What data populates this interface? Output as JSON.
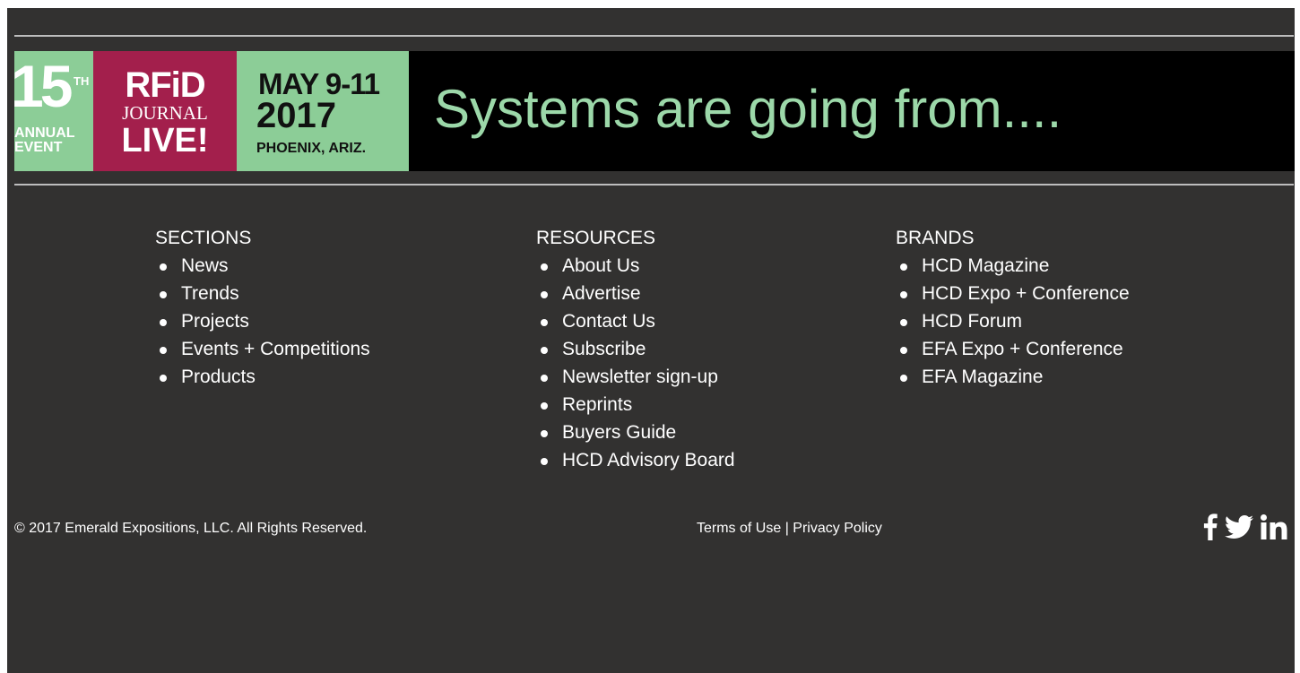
{
  "banner": {
    "number": "15",
    "number_suffix": "TH",
    "annual": "ANNUAL",
    "event": "EVENT",
    "brand_top": "RFiD",
    "brand_mid": "JOURNAL",
    "brand_bottom": "LIVE!",
    "date": "MAY 9-11",
    "year": "2017",
    "city": "PHOENIX, ARIZ.",
    "tagline": "Systems are going from....",
    "colors": {
      "green": "#8ccd97",
      "crimson": "#a31f4c",
      "tagline": "#9cd8a9"
    }
  },
  "sections": {
    "heading": "SECTIONS",
    "items": [
      "News",
      "Trends",
      "Projects",
      "Events + Competitions",
      "Products"
    ]
  },
  "resources": {
    "heading": "RESOURCES",
    "items": [
      "About Us",
      "Advertise",
      "Contact Us",
      "Subscribe",
      "Newsletter sign-up",
      "Reprints",
      "Buyers Guide",
      "HCD Advisory Board"
    ]
  },
  "brands": {
    "heading": "BRANDS",
    "items": [
      "HCD Magazine",
      "HCD Expo + Conference",
      "HCD Forum",
      "EFA Expo + Conference",
      "EFA Magazine"
    ]
  },
  "footer": {
    "copyright": "© 2017 Emerald Expositions, LLC. All Rights Reserved.",
    "terms": "Terms of Use",
    "separator": " | ",
    "privacy": "Privacy Policy",
    "social": [
      {
        "icon": "facebook-icon"
      },
      {
        "icon": "twitter-icon"
      },
      {
        "icon": "linkedin-icon"
      }
    ],
    "background": "#323130"
  }
}
